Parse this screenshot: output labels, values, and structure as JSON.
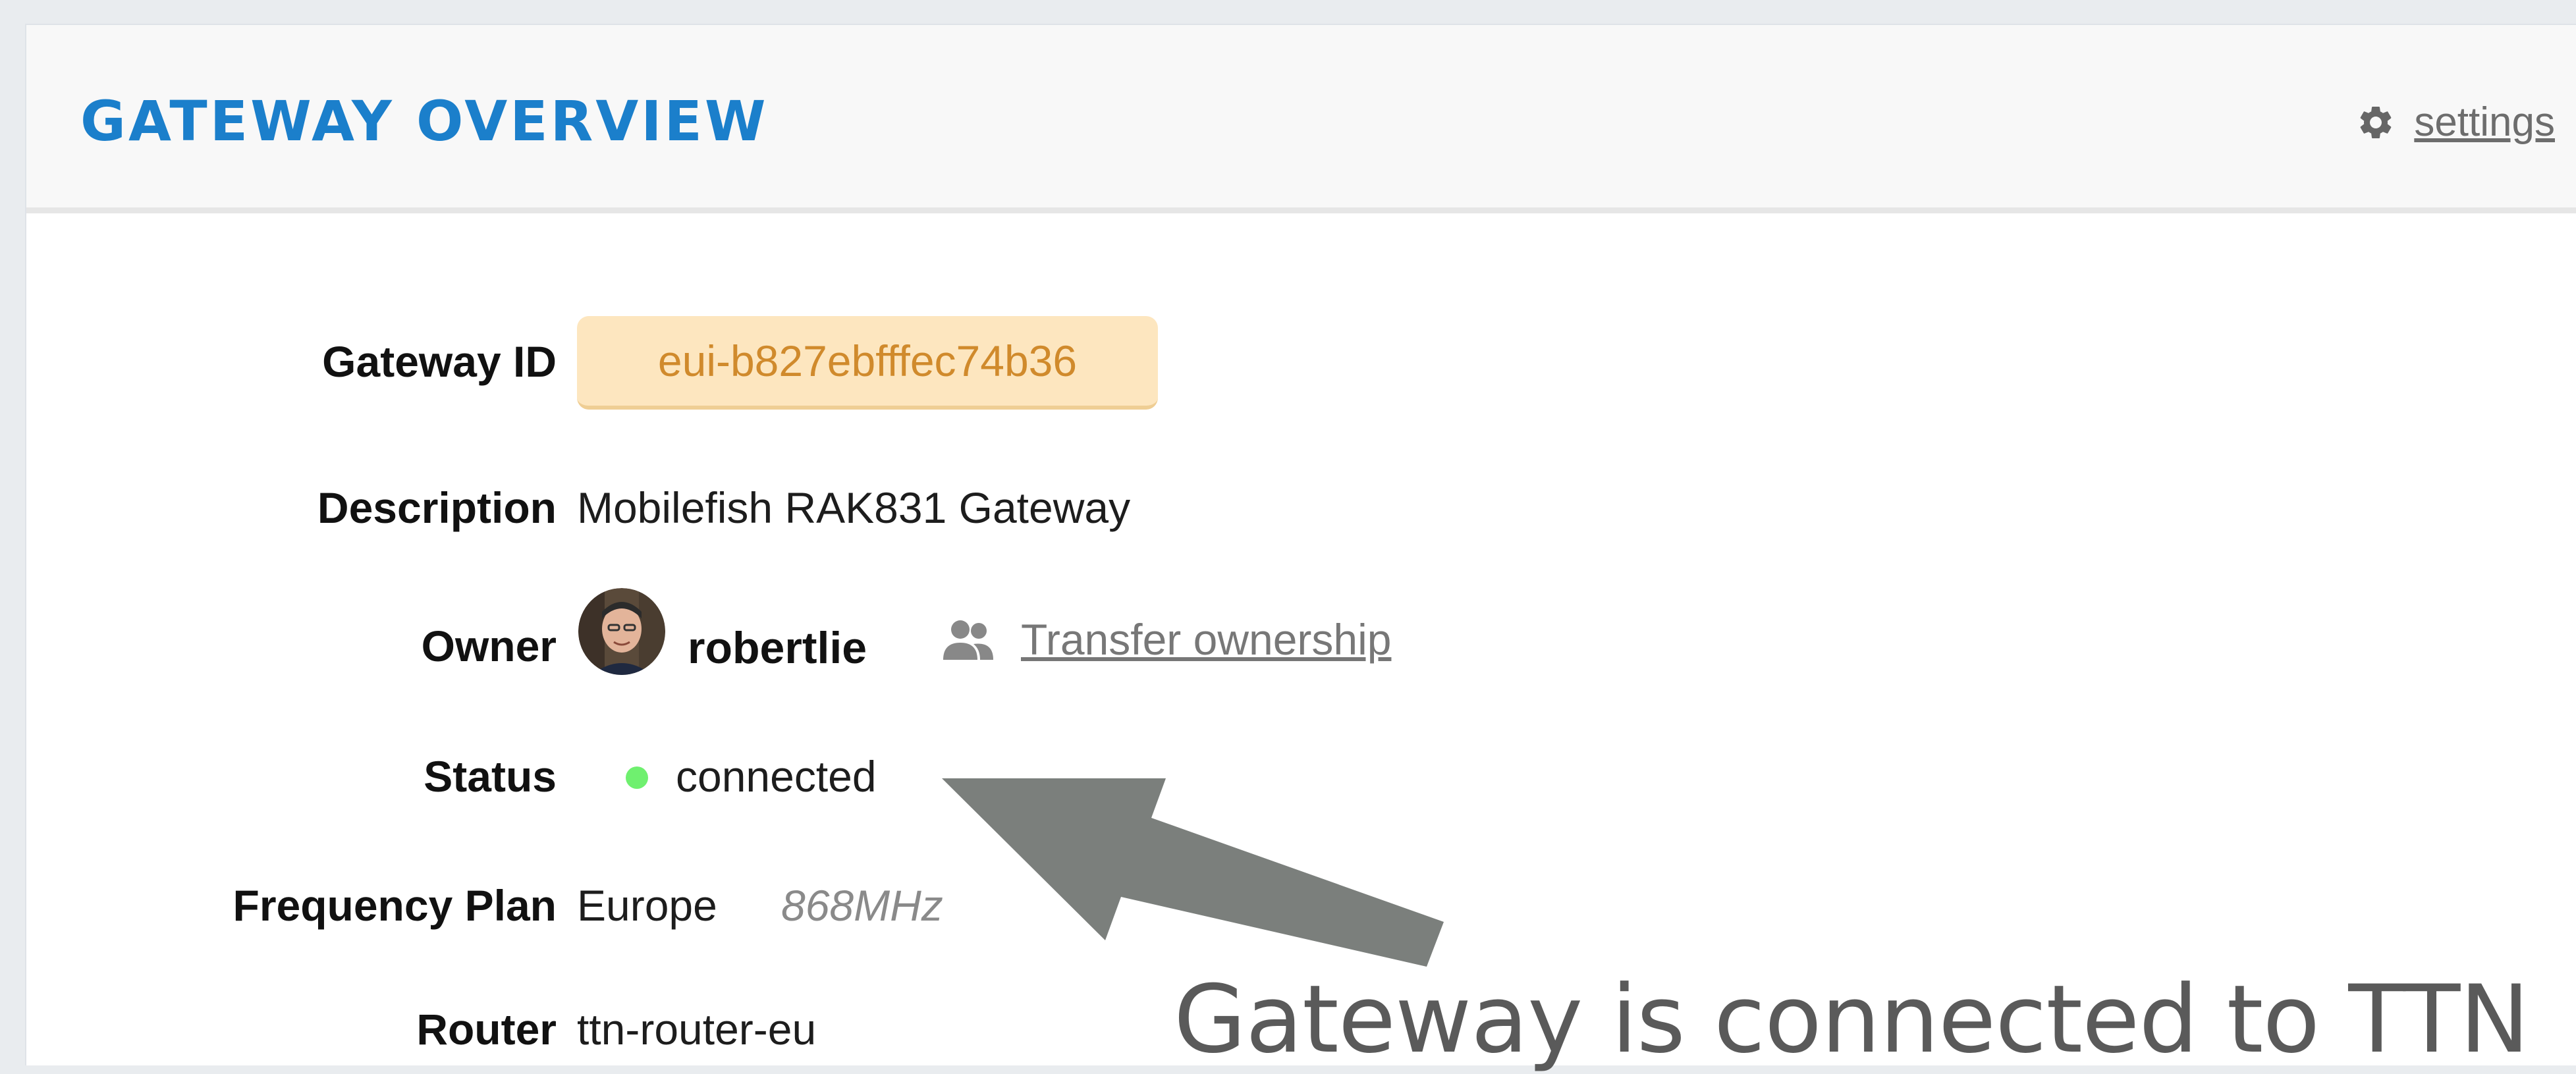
{
  "header": {
    "title": "GATEWAY OVERVIEW",
    "settings_label": "settings"
  },
  "fields": {
    "gateway_id": {
      "label": "Gateway ID",
      "value": "eui-b827ebfffec74b36"
    },
    "description": {
      "label": "Description",
      "value": "Mobilefish RAK831 Gateway"
    },
    "owner": {
      "label": "Owner",
      "name": "robertlie",
      "transfer_label": "Transfer ownership"
    },
    "status": {
      "label": "Status",
      "value": "connected"
    },
    "frequency_plan": {
      "label": "Frequency Plan",
      "region": "Europe",
      "band": "868MHz"
    },
    "router": {
      "label": "Router",
      "value": "ttn-router-eu"
    }
  },
  "annotation": {
    "text": "Gateway is connected to TTN"
  },
  "icons": {
    "settings": "gear-icon",
    "transfer": "users-icon",
    "status": "status-dot-icon",
    "avatar": "avatar"
  },
  "colors": {
    "title": "#1b7fcb",
    "gateway_id_bg": "#fde6bf",
    "gateway_id_text": "#d08a2c",
    "status_connected": "#6ff06f",
    "arrow": "#7b7f7c"
  }
}
